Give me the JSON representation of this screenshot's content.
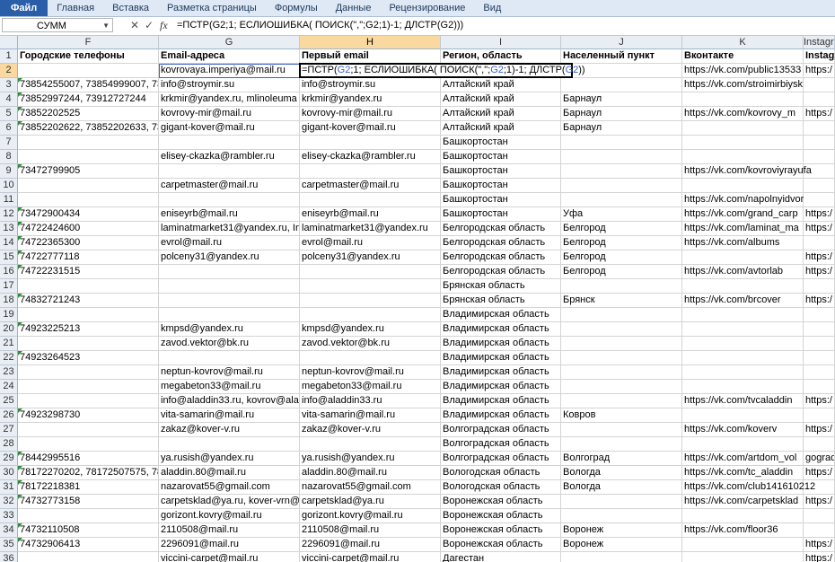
{
  "ribbon": {
    "tabs": [
      "Файл",
      "Главная",
      "Вставка",
      "Разметка страницы",
      "Формулы",
      "Данные",
      "Рецензирование",
      "Вид"
    ]
  },
  "formula_bar": {
    "name_box": "СУММ",
    "cancel_glyph": "✕",
    "enter_glyph": "✓",
    "fx": "fx",
    "formula": "=ПСТР(G2;1; ЕСЛИОШИБКА( ПОИСК(\",\";G2;1)-1; ДЛСТР(G2)))"
  },
  "active_cell": {
    "parts": [
      {
        "t": "=ПСТР(",
        "c": ""
      },
      {
        "t": "G2",
        "c": "r1"
      },
      {
        "t": ";1; ЕСЛИОШИБКА( ПОИСК(\",\";",
        "c": ""
      },
      {
        "t": "G2",
        "c": "r1"
      },
      {
        "t": ";1)-1; ДЛСТР(",
        "c": ""
      },
      {
        "t": "G2",
        "c": "r1"
      },
      {
        "t": "))",
        "c": ""
      }
    ]
  },
  "columns": [
    {
      "letter": "F",
      "width": 157,
      "selected": false
    },
    {
      "letter": "G",
      "width": 157,
      "selected": false
    },
    {
      "letter": "H",
      "width": 157,
      "selected": true
    },
    {
      "letter": "I",
      "width": 134,
      "selected": false
    },
    {
      "letter": "J",
      "width": 135,
      "selected": false
    },
    {
      "letter": "K",
      "width": 135,
      "selected": false
    },
    {
      "letter": "Instagra",
      "width": 35,
      "selected": false
    }
  ],
  "rows": [
    {
      "n": "1",
      "cells": [
        "Городские телефоны",
        "Email-адреса",
        "Первый email",
        "Регион, область",
        "Населенный пункт",
        "Вконтакте",
        "Instagra"
      ],
      "tri": false
    },
    {
      "n": "2",
      "cells": [
        "",
        "kovrovaya.imperiya@mail.ru",
        "",
        "",
        "",
        "https://vk.com/public13533",
        "https:/"
      ],
      "tri": false
    },
    {
      "n": "3",
      "cells": [
        "73854255007, 73854999007, 7385",
        "info@stroymir.su",
        "info@stroymir.su",
        "Алтайский край",
        "",
        "https://vk.com/stroimirbiysk",
        ""
      ],
      "tri": true
    },
    {
      "n": "4",
      "cells": [
        "73852997244, 73912727244",
        "krkmir@yandex.ru, mlinoleuma",
        "krkmir@yandex.ru",
        "Алтайский край",
        "Барнаул",
        "",
        ""
      ],
      "tri": true
    },
    {
      "n": "5",
      "cells": [
        "73852202525",
        "kovrovy-mir@mail.ru",
        "kovrovy-mir@mail.ru",
        "Алтайский край",
        "Барнаул",
        "https://vk.com/kovrovy_m",
        "https:/"
      ],
      "tri": true
    },
    {
      "n": "6",
      "cells": [
        "73852202622, 73852202633, 7385",
        "gigant-kover@mail.ru",
        "gigant-kover@mail.ru",
        "Алтайский край",
        "Барнаул",
        "",
        ""
      ],
      "tri": true
    },
    {
      "n": "7",
      "cells": [
        "",
        "",
        "",
        "Башкортостан",
        "",
        "",
        ""
      ],
      "tri": false
    },
    {
      "n": "8",
      "cells": [
        "",
        "elisey-ckazka@rambler.ru",
        "elisey-ckazka@rambler.ru",
        "Башкортостан",
        "",
        "",
        ""
      ],
      "tri": false
    },
    {
      "n": "9",
      "cells": [
        "73472799905",
        "",
        "",
        "Башкортостан",
        "",
        "https://vk.com/kovroviyrayufa",
        ""
      ],
      "tri": true
    },
    {
      "n": "10",
      "cells": [
        "",
        "carpetmaster@mail.ru",
        "carpetmaster@mail.ru",
        "Башкортостан",
        "",
        "",
        ""
      ],
      "tri": false
    },
    {
      "n": "11",
      "cells": [
        "",
        "",
        "",
        "Башкортостан",
        "",
        "https://vk.com/napolnyidvor",
        ""
      ],
      "tri": false
    },
    {
      "n": "12",
      "cells": [
        "73472900434",
        "eniseyrb@mail.ru",
        "eniseyrb@mail.ru",
        "Башкортостан",
        "Уфа",
        "https://vk.com/grand_carp",
        "https:/"
      ],
      "tri": true
    },
    {
      "n": "13",
      "cells": [
        "74722424600",
        "laminatmarket31@yandex.ru, In",
        "laminatmarket31@yandex.ru",
        "Белгородская область",
        "Белгород",
        "https://vk.com/laminat_ma",
        "https:/"
      ],
      "tri": true
    },
    {
      "n": "14",
      "cells": [
        "74722365300",
        "evrol@mail.ru",
        "evrol@mail.ru",
        "Белгородская область",
        "Белгород",
        "https://vk.com/albums",
        ""
      ],
      "tri": true
    },
    {
      "n": "15",
      "cells": [
        "74722777118",
        "polceny31@yandex.ru",
        "polceny31@yandex.ru",
        "Белгородская область",
        "Белгород",
        "",
        "https:/"
      ],
      "tri": true
    },
    {
      "n": "16",
      "cells": [
        "74722231515",
        "",
        "",
        "Белгородская область",
        "Белгород",
        "https://vk.com/avtorlab",
        "https:/"
      ],
      "tri": true
    },
    {
      "n": "17",
      "cells": [
        "",
        "",
        "",
        "Брянская область",
        "",
        "",
        ""
      ],
      "tri": false
    },
    {
      "n": "18",
      "cells": [
        "74832721243",
        "",
        "",
        "Брянская область",
        "Брянск",
        "https://vk.com/brcover",
        "https:/"
      ],
      "tri": true
    },
    {
      "n": "19",
      "cells": [
        "",
        "",
        "",
        "Владимирская область",
        "",
        "",
        ""
      ],
      "tri": false
    },
    {
      "n": "20",
      "cells": [
        "74923225213",
        "kmpsd@yandex.ru",
        "kmpsd@yandex.ru",
        "Владимирская область",
        "",
        "",
        ""
      ],
      "tri": true
    },
    {
      "n": "21",
      "cells": [
        "",
        "zavod.vektor@bk.ru",
        "zavod.vektor@bk.ru",
        "Владимирская область",
        "",
        "",
        ""
      ],
      "tri": false
    },
    {
      "n": "22",
      "cells": [
        "74923264523",
        "",
        "",
        "Владимирская область",
        "",
        "",
        ""
      ],
      "tri": true
    },
    {
      "n": "23",
      "cells": [
        "",
        "neptun-kovrov@mail.ru",
        "neptun-kovrov@mail.ru",
        "Владимирская область",
        "",
        "",
        ""
      ],
      "tri": false
    },
    {
      "n": "24",
      "cells": [
        "",
        "megabeton33@mail.ru",
        "megabeton33@mail.ru",
        "Владимирская область",
        "",
        "",
        ""
      ],
      "tri": false
    },
    {
      "n": "25",
      "cells": [
        "",
        "info@aladdin33.ru, kovrov@ala",
        "info@aladdin33.ru",
        "Владимирская область",
        "",
        "https://vk.com/tvcaladdin",
        "https:/"
      ],
      "tri": false
    },
    {
      "n": "26",
      "cells": [
        "74923298730",
        "vita-samarin@mail.ru",
        "vita-samarin@mail.ru",
        "Владимирская область",
        "Ковров",
        "",
        ""
      ],
      "tri": true
    },
    {
      "n": "27",
      "cells": [
        "",
        "zakaz@kover-v.ru",
        "zakaz@kover-v.ru",
        "Волгоградская область",
        "",
        "https://vk.com/koverv",
        "https:/"
      ],
      "tri": false
    },
    {
      "n": "28",
      "cells": [
        "",
        "",
        "",
        "Волгоградская область",
        "",
        "",
        ""
      ],
      "tri": false
    },
    {
      "n": "29",
      "cells": [
        "78442995516",
        "ya.rusish@yandex.ru",
        "ya.rusish@yandex.ru",
        "Волгоградская область",
        "Волгоград",
        "https://vk.com/artdom_vol",
        "gograd"
      ],
      "tri": true
    },
    {
      "n": "30",
      "cells": [
        "78172270202, 78172507575, 7817",
        "aladdin.80@mail.ru",
        "aladdin.80@mail.ru",
        "Вологодская область",
        "Вологда",
        "https://vk.com/tc_aladdin",
        "https:/"
      ],
      "tri": true
    },
    {
      "n": "31",
      "cells": [
        "78172218381",
        "nazarovat55@gmail.com",
        "nazarovat55@gmail.com",
        "Вологодская область",
        "Вологда",
        "https://vk.com/club141610212",
        ""
      ],
      "tri": true
    },
    {
      "n": "32",
      "cells": [
        "74732773158",
        "carpetsklad@ya.ru, kover-vrn@",
        "carpetsklad@ya.ru",
        "Воронежская область",
        "",
        "https://vk.com/carpetsklad",
        "https:/"
      ],
      "tri": true
    },
    {
      "n": "33",
      "cells": [
        "",
        "gorizont.kovry@mail.ru",
        "gorizont.kovry@mail.ru",
        "Воронежская область",
        "",
        "",
        ""
      ],
      "tri": false
    },
    {
      "n": "34",
      "cells": [
        "74732110508",
        "2110508@mail.ru",
        "2110508@mail.ru",
        "Воронежская область",
        "Воронеж",
        "https://vk.com/floor36",
        ""
      ],
      "tri": true
    },
    {
      "n": "35",
      "cells": [
        "74732906413",
        "2296091@mail.ru",
        "2296091@mail.ru",
        "Воронежская область",
        "Воронеж",
        "",
        "https:/"
      ],
      "tri": true
    },
    {
      "n": "36",
      "cells": [
        "",
        "viccini-carpet@mail.ru",
        "viccini-carpet@mail.ru",
        "Дагестан",
        "",
        "",
        "https:/"
      ],
      "tri": false
    }
  ],
  "colors": {
    "selection_header": "#f9d99f",
    "reference_blue": "#3b62c9",
    "ribbon_file": "#2a5ea8"
  }
}
